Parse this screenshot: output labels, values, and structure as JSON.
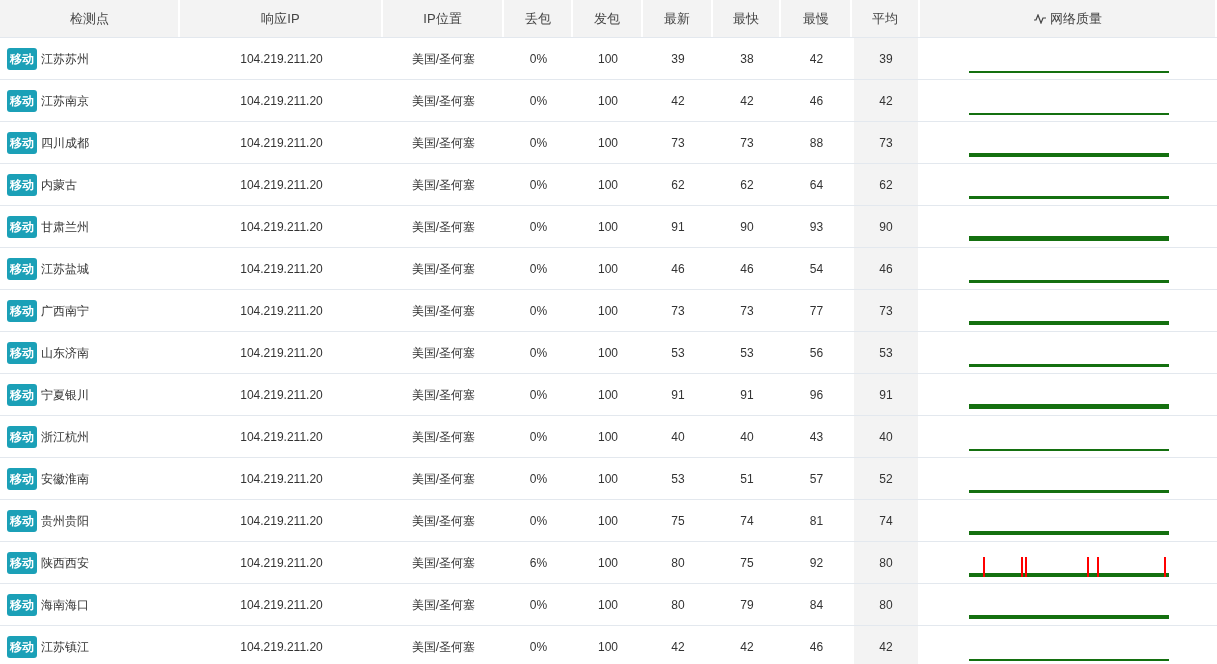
{
  "table": {
    "columns": [
      "检测点",
      "响应IP",
      "IP位置",
      "丢包",
      "发包",
      "最新",
      "最快",
      "最慢",
      "平均",
      "网络质量"
    ],
    "rows": [
      {
        "isp": "移动",
        "node": "江苏苏州",
        "ip": "104.219.211.20",
        "location": "美国/圣何塞",
        "loss": "0%",
        "sent": "100",
        "latest": "39",
        "fastest": "38",
        "slowest": "42",
        "average": "39",
        "packet_loss": false
      },
      {
        "isp": "移动",
        "node": "江苏南京",
        "ip": "104.219.211.20",
        "location": "美国/圣何塞",
        "loss": "0%",
        "sent": "100",
        "latest": "42",
        "fastest": "42",
        "slowest": "46",
        "average": "42",
        "packet_loss": false
      },
      {
        "isp": "移动",
        "node": "四川成都",
        "ip": "104.219.211.20",
        "location": "美国/圣何塞",
        "loss": "0%",
        "sent": "100",
        "latest": "73",
        "fastest": "73",
        "slowest": "88",
        "average": "73",
        "packet_loss": false
      },
      {
        "isp": "移动",
        "node": "内蒙古",
        "ip": "104.219.211.20",
        "location": "美国/圣何塞",
        "loss": "0%",
        "sent": "100",
        "latest": "62",
        "fastest": "62",
        "slowest": "64",
        "average": "62",
        "packet_loss": false
      },
      {
        "isp": "移动",
        "node": "甘肃兰州",
        "ip": "104.219.211.20",
        "location": "美国/圣何塞",
        "loss": "0%",
        "sent": "100",
        "latest": "91",
        "fastest": "90",
        "slowest": "93",
        "average": "90",
        "packet_loss": false
      },
      {
        "isp": "移动",
        "node": "江苏盐城",
        "ip": "104.219.211.20",
        "location": "美国/圣何塞",
        "loss": "0%",
        "sent": "100",
        "latest": "46",
        "fastest": "46",
        "slowest": "54",
        "average": "46",
        "packet_loss": false
      },
      {
        "isp": "移动",
        "node": "广西南宁",
        "ip": "104.219.211.20",
        "location": "美国/圣何塞",
        "loss": "0%",
        "sent": "100",
        "latest": "73",
        "fastest": "73",
        "slowest": "77",
        "average": "73",
        "packet_loss": false
      },
      {
        "isp": "移动",
        "node": "山东济南",
        "ip": "104.219.211.20",
        "location": "美国/圣何塞",
        "loss": "0%",
        "sent": "100",
        "latest": "53",
        "fastest": "53",
        "slowest": "56",
        "average": "53",
        "packet_loss": false
      },
      {
        "isp": "移动",
        "node": "宁夏银川",
        "ip": "104.219.211.20",
        "location": "美国/圣何塞",
        "loss": "0%",
        "sent": "100",
        "latest": "91",
        "fastest": "91",
        "slowest": "96",
        "average": "91",
        "packet_loss": false
      },
      {
        "isp": "移动",
        "node": "浙江杭州",
        "ip": "104.219.211.20",
        "location": "美国/圣何塞",
        "loss": "0%",
        "sent": "100",
        "latest": "40",
        "fastest": "40",
        "slowest": "43",
        "average": "40",
        "packet_loss": false
      },
      {
        "isp": "移动",
        "node": "安徽淮南",
        "ip": "104.219.211.20",
        "location": "美国/圣何塞",
        "loss": "0%",
        "sent": "100",
        "latest": "53",
        "fastest": "51",
        "slowest": "57",
        "average": "52",
        "packet_loss": false
      },
      {
        "isp": "移动",
        "node": "贵州贵阳",
        "ip": "104.219.211.20",
        "location": "美国/圣何塞",
        "loss": "0%",
        "sent": "100",
        "latest": "75",
        "fastest": "74",
        "slowest": "81",
        "average": "74",
        "packet_loss": false
      },
      {
        "isp": "移动",
        "node": "陕西西安",
        "ip": "104.219.211.20",
        "location": "美国/圣何塞",
        "loss": "6%",
        "sent": "100",
        "latest": "80",
        "fastest": "75",
        "slowest": "92",
        "average": "80",
        "packet_loss": true
      },
      {
        "isp": "移动",
        "node": "海南海口",
        "ip": "104.219.211.20",
        "location": "美国/圣何塞",
        "loss": "0%",
        "sent": "100",
        "latest": "80",
        "fastest": "79",
        "slowest": "84",
        "average": "80",
        "packet_loss": false
      },
      {
        "isp": "移动",
        "node": "江苏镇江",
        "ip": "104.219.211.20",
        "location": "美国/圣何塞",
        "loss": "0%",
        "sent": "100",
        "latest": "42",
        "fastest": "42",
        "slowest": "46",
        "average": "42",
        "packet_loss": false
      }
    ]
  }
}
